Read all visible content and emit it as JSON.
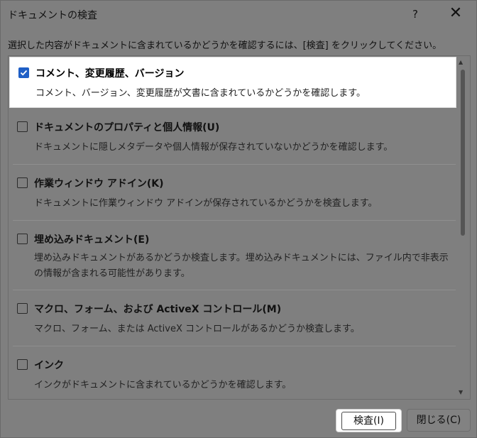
{
  "window": {
    "title": "ドキュメントの検査",
    "help_label": "?",
    "close_label": "✕"
  },
  "instruction": "選択した内容がドキュメントに含まれているかどうかを確認するには、[検査] をクリックしてください。",
  "items": [
    {
      "title": "コメント、変更履歴、バージョン",
      "desc": "コメント、バージョン、変更履歴が文書に含まれているかどうかを確認します。",
      "checked": true
    },
    {
      "title": "ドキュメントのプロパティと個人情報(U)",
      "desc": "ドキュメントに隠しメタデータや個人情報が保存されていないかどうかを確認します。",
      "checked": false
    },
    {
      "title": "作業ウィンドウ アドイン(K)",
      "desc": "ドキュメントに作業ウィンドウ アドインが保存されているかどうかを検査します。",
      "checked": false
    },
    {
      "title": "埋め込みドキュメント(E)",
      "desc": "埋め込みドキュメントがあるかどうか検査します。埋め込みドキュメントには、ファイル内で非表示の情報が含まれる可能性があります。",
      "checked": false
    },
    {
      "title": "マクロ、フォーム、および ActiveX コントロール(M)",
      "desc": "マクロ、フォーム、または ActiveX コントロールがあるかどうか検査します。",
      "checked": false
    },
    {
      "title": "インク",
      "desc": "インクがドキュメントに含まれているかどうかを確認します。",
      "checked": false
    }
  ],
  "buttons": {
    "inspect": "検査(I)",
    "close": "閉じる(C)"
  },
  "colors": {
    "accent": "#1f5fc6",
    "overlay": "#7f7f7f"
  }
}
